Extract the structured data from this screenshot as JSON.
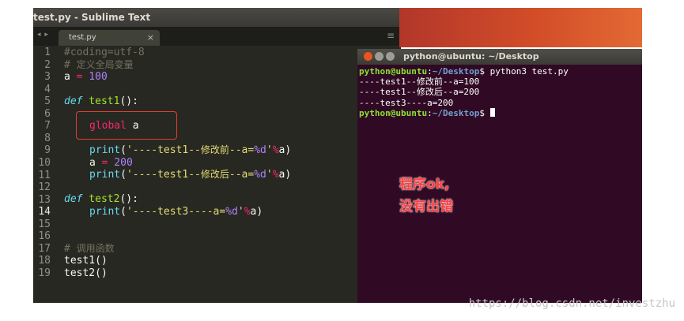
{
  "editor": {
    "window_title": "test.py - Sublime Text",
    "tab_label": "test.py",
    "tab_close": "×",
    "nav_arrows": "◂ ▸",
    "menu_icon": "≡",
    "line_numbers": [
      "1",
      "2",
      "3",
      "4",
      "5",
      "6",
      "7",
      "8",
      "9",
      "10",
      "11",
      "12",
      "13",
      "14",
      "15",
      "16",
      "17",
      "18",
      "19"
    ],
    "current_line": "14",
    "code": {
      "l1": "#coding=utf-8",
      "l2_hash": "# ",
      "l2_comment": "定义全局变量",
      "l3_var": "a ",
      "l3_op": "=",
      "l3_num": " 100",
      "l5_def": "def",
      "l5_name": " test1",
      "l5_rest": "():",
      "l7_kw": "global",
      "l7_var": " a",
      "l9_fn": "print",
      "l9_open": "(",
      "l9_str1": "'----test1--",
      "l9_zh": "修改前",
      "l9_str2": "--a=",
      "l9_fmt": "%d",
      "l9_str3": "'",
      "l9_op": "%",
      "l9_end": "a)",
      "l10_var": "a ",
      "l10_op": "=",
      "l10_num": " 200",
      "l11_fn": "print",
      "l11_open": "(",
      "l11_str1": "'----test1--",
      "l11_zh": "修改后",
      "l11_str2": "--a=",
      "l11_fmt": "%d",
      "l11_str3": "'",
      "l11_op": "%",
      "l11_end": "a)",
      "l13_def": "def",
      "l13_name": " test2",
      "l13_rest": "():",
      "l14_fn": "print",
      "l14_open": "(",
      "l14_str1": "'----test3----a=",
      "l14_fmt": "%d",
      "l14_str3": "'",
      "l14_op": "%",
      "l14_end": "a)",
      "l17_hash": "# ",
      "l17_comment": "调用函数",
      "l18": "test1()",
      "l19": "test2()"
    }
  },
  "terminal": {
    "title": "python@ubuntu: ~/Desktop",
    "prompt_user": "python@ubuntu",
    "prompt_colon": ":",
    "prompt_path": "~/Desktop",
    "prompt_dollar": "$ ",
    "command": "python3 test.py",
    "output": [
      "----test1--修改前--a=100",
      "----test1--修改后--a=200",
      "----test3----a=200"
    ],
    "colors": {
      "close": "#e95420",
      "minimize": "#9c9b97",
      "maximize": "#9c9b97",
      "background": "#300a24"
    }
  },
  "annotation": {
    "line1": "程序ok,",
    "line2": "没有出错"
  },
  "watermark": "https://blog.csdn.net/investzhu"
}
